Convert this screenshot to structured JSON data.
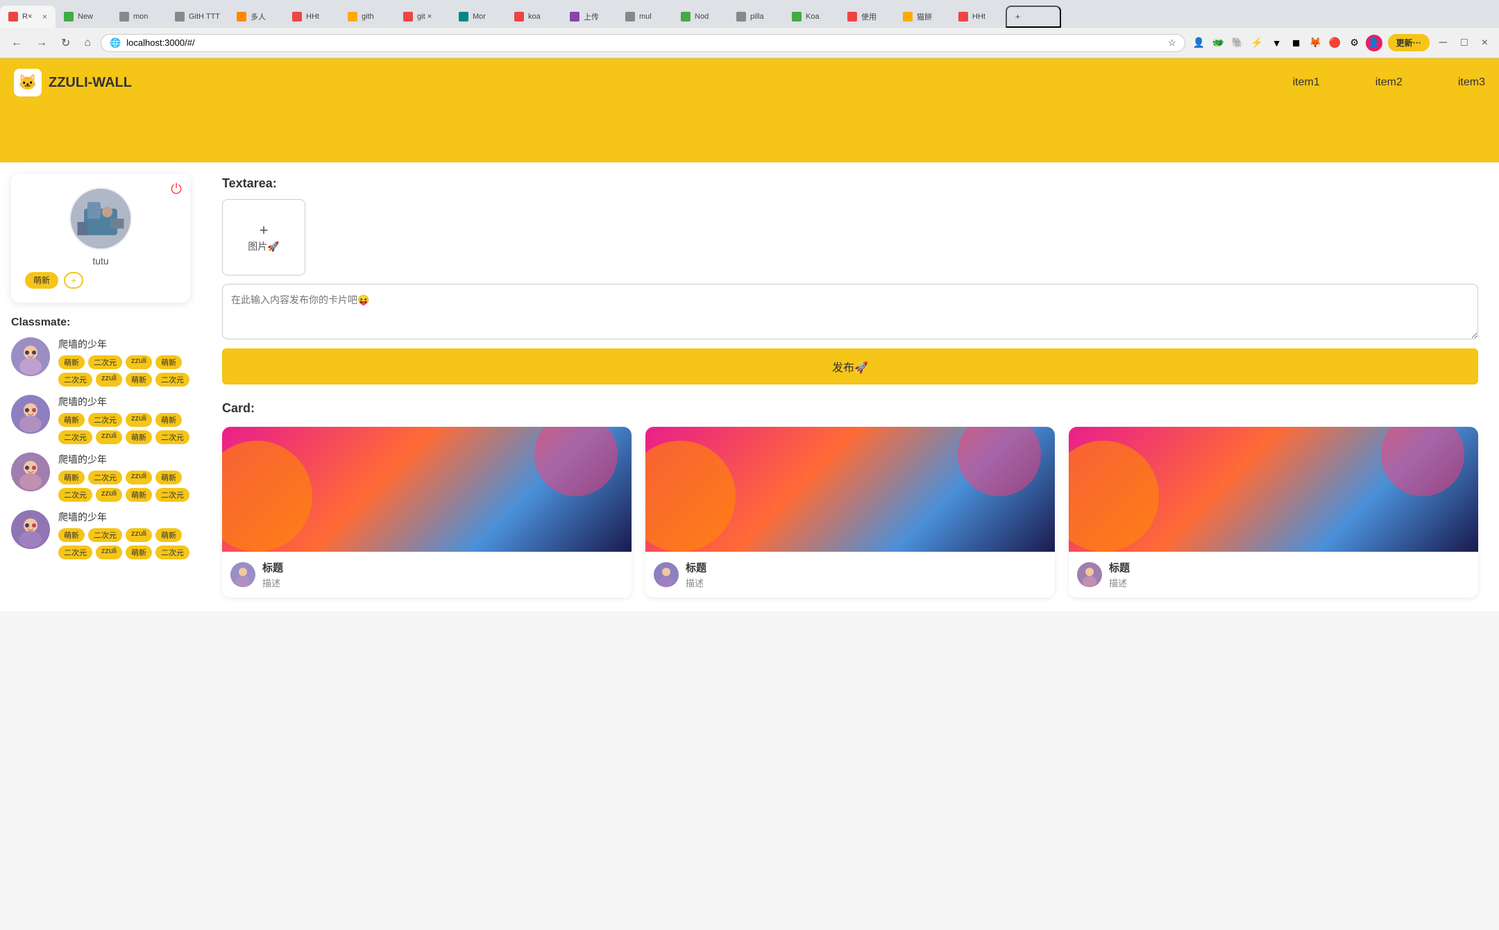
{
  "browser": {
    "url": "localhost:3000/#/",
    "tabs": [
      {
        "id": "t1",
        "label": "R×",
        "favicon_color": "#e44",
        "active": true
      },
      {
        "id": "t2",
        "label": "New",
        "favicon_color": "#4a4",
        "active": false
      },
      {
        "id": "t3",
        "label": "mon",
        "favicon_color": "#888",
        "active": false
      },
      {
        "id": "t4",
        "label": "GitH TTT",
        "favicon_color": "#333",
        "active": false
      },
      {
        "id": "t5",
        "label": "多人",
        "favicon_color": "#f80",
        "active": false
      },
      {
        "id": "t6",
        "label": "HHt",
        "favicon_color": "#e44",
        "active": false
      },
      {
        "id": "t7",
        "label": "gith",
        "favicon_color": "#fa0",
        "active": false
      },
      {
        "id": "t8",
        "label": "git ×",
        "favicon_color": "#e44",
        "active": false
      },
      {
        "id": "t9",
        "label": "Mor",
        "favicon_color": "#088",
        "active": false
      },
      {
        "id": "t10",
        "label": "koa",
        "favicon_color": "#e44",
        "active": false
      },
      {
        "id": "t11",
        "label": "上传",
        "favicon_color": "#84a",
        "active": false
      },
      {
        "id": "t12",
        "label": "mul",
        "favicon_color": "#888",
        "active": false
      },
      {
        "id": "t13",
        "label": "Nod",
        "favicon_color": "#4a4",
        "active": false
      },
      {
        "id": "t14",
        "label": "pillа",
        "favicon_color": "#888",
        "active": false
      },
      {
        "id": "t15",
        "label": "Koa",
        "favicon_color": "#4a4",
        "active": false
      },
      {
        "id": "t16",
        "label": "使用",
        "favicon_color": "#e44",
        "active": false
      },
      {
        "id": "t17",
        "label": "猫餅",
        "favicon_color": "#fa0",
        "active": false
      },
      {
        "id": "t18",
        "label": "HHt",
        "favicon_color": "#e44",
        "active": false
      }
    ],
    "update_btn": "更新⋯"
  },
  "nav": {
    "logo_icon": "🐱",
    "logo_text": "ZZULI-WALL",
    "items": [
      "item1",
      "item2",
      "item3"
    ]
  },
  "sidebar": {
    "profile": {
      "username": "tutu",
      "tags": [
        "萌新",
        "+"
      ]
    },
    "classmate_title": "Classmate:",
    "classmates": [
      {
        "name": "爬墙的少年",
        "tags": [
          "萌新",
          "二次元",
          "zzuli",
          "萌新",
          "二次元",
          "zzuli",
          "萌新",
          "二次元"
        ]
      },
      {
        "name": "爬墙的少年",
        "tags": [
          "萌新",
          "二次元",
          "zzuli",
          "萌新",
          "二次元",
          "zzuli",
          "萌新",
          "二次元"
        ]
      },
      {
        "name": "爬墙的少年",
        "tags": [
          "萌新",
          "二次元",
          "zzuli",
          "萌新",
          "二次元",
          "zzuli",
          "萌新",
          "二次元"
        ]
      },
      {
        "name": "爬墙的少年",
        "tags": [
          "萌新",
          "二次元",
          "zzuli",
          "萌新",
          "二次元",
          "zzuli",
          "萌新",
          "二次元"
        ]
      }
    ]
  },
  "content": {
    "textarea_label": "Textarea:",
    "image_upload_plus": "+",
    "image_upload_label": "图片🚀",
    "textarea_placeholder": "在此输入内容发布你的卡片吧😝",
    "publish_btn": "发布🚀",
    "card_label": "Card:",
    "cards": [
      {
        "title": "标题",
        "desc": "描述"
      },
      {
        "title": "标题",
        "desc": "描述"
      },
      {
        "title": "标题",
        "desc": "描述"
      }
    ]
  }
}
